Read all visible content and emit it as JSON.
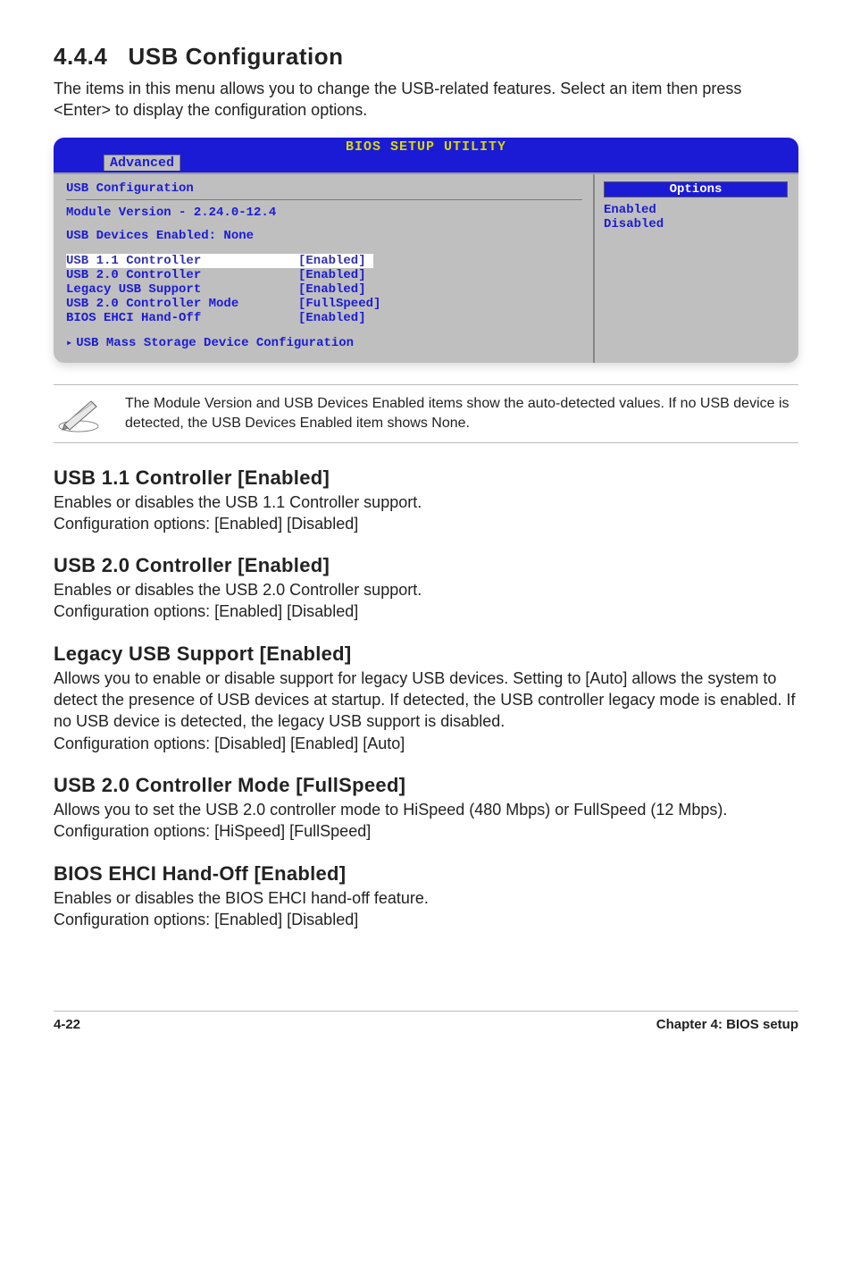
{
  "section": {
    "number": "4.4.4",
    "title": "USB Configuration",
    "intro": "The items in this menu allows you to change the USB-related features. Select an item then press <Enter> to display the configuration options."
  },
  "bios": {
    "title": "BIOS SETUP UTILITY",
    "tab": "Advanced",
    "heading": "USB Configuration",
    "module_line": "Module Version - 2.24.0-12.4",
    "devices_line": "USB Devices Enabled: None",
    "rows": [
      {
        "label": "USB 1.1 Controller",
        "value": "[Enabled]",
        "highlight": true
      },
      {
        "label": "USB 2.0 Controller",
        "value": "[Enabled]",
        "highlight": false
      },
      {
        "label": "Legacy USB Support",
        "value": "[Enabled]",
        "highlight": false
      },
      {
        "label": "USB 2.0 Controller Mode",
        "value": "[FullSpeed]",
        "highlight": false
      },
      {
        "label": "BIOS EHCI Hand-Off",
        "value": "[Enabled]",
        "highlight": false
      }
    ],
    "submenu": "USB Mass Storage Device Configuration",
    "options_title": "Options",
    "options": [
      "Enabled",
      "Disabled"
    ]
  },
  "note": "The Module Version and USB Devices Enabled items show the auto-detected values. If no USB device is detected, the USB Devices Enabled item shows None.",
  "subs": [
    {
      "title": "USB 1.1 Controller [Enabled]",
      "body": "Enables or disables the USB 1.1 Controller support.\nConfiguration options: [Enabled] [Disabled]"
    },
    {
      "title": "USB 2.0 Controller [Enabled]",
      "body": "Enables or disables the USB 2.0 Controller support.\nConfiguration options: [Enabled] [Disabled]"
    },
    {
      "title": "Legacy USB Support [Enabled]",
      "body": "Allows you to enable or disable support for legacy USB devices. Setting to [Auto] allows the system to detect the presence of USB devices at startup. If detected, the USB controller legacy mode is enabled. If no USB device is detected, the legacy USB support is disabled.\nConfiguration options: [Disabled] [Enabled] [Auto]"
    },
    {
      "title": "USB 2.0 Controller Mode [FullSpeed]",
      "body": "Allows you to set the USB 2.0 controller mode to HiSpeed (480 Mbps) or FullSpeed (12 Mbps). Configuration options: [HiSpeed] [FullSpeed]"
    },
    {
      "title": "BIOS EHCI Hand-Off [Enabled]",
      "body": "Enables or disables the BIOS EHCI hand-off feature.\nConfiguration options: [Enabled] [Disabled]"
    }
  ],
  "footer": {
    "left": "4-22",
    "right": "Chapter 4: BIOS setup"
  }
}
